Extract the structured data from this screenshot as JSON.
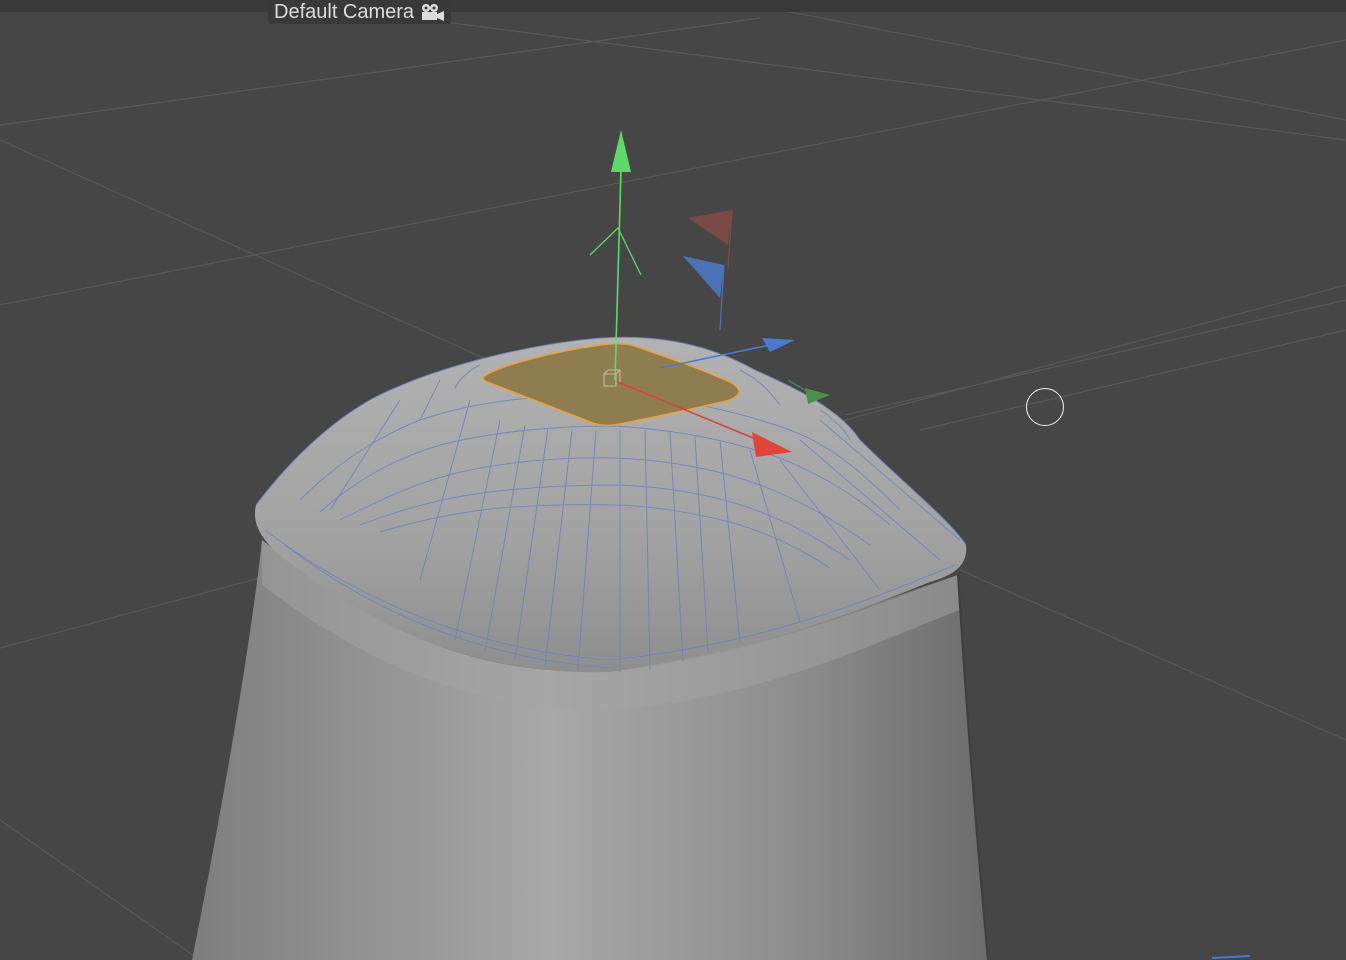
{
  "viewport": {
    "camera_label": "Default Camera",
    "camera_icon": "camera-icon"
  },
  "colors": {
    "background": "#464646",
    "grid": "#5a5a5a",
    "mesh": "#9a9a9a",
    "wireframe": "#6b84b8",
    "selection_fill": "#8a7a52",
    "selection_outline": "#e8a040",
    "axis_y": "#5fd86a",
    "axis_x": "#e0443a",
    "axis_z": "#4a7ad0"
  }
}
